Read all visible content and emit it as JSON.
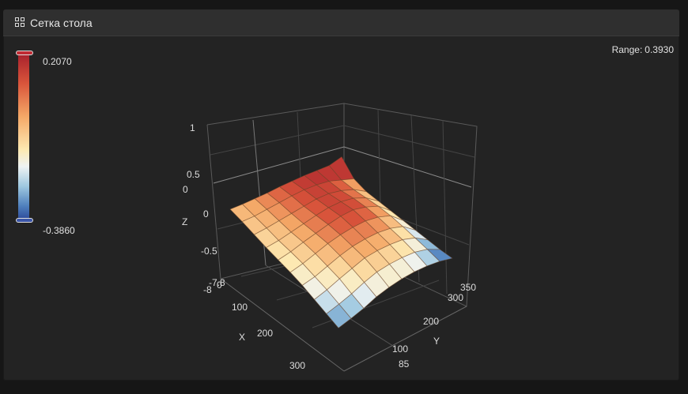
{
  "header": {
    "title": "Сетка стола",
    "icon": "grid-icon"
  },
  "range": {
    "label": "Range:",
    "value": "0.3930"
  },
  "color_scale": {
    "max": "0.2070",
    "min": "-0.3860"
  },
  "axes": {
    "z_label": "Z",
    "x_label": "X",
    "y_label": "Y",
    "z_ticks": [
      "1",
      "0.5",
      "0",
      "0",
      "-0.5",
      "-7.8",
      "-8"
    ],
    "x_ticks": [
      "0",
      "100",
      "200",
      "300"
    ],
    "y_ticks": [
      "350",
      "300",
      "200",
      "100",
      "85"
    ]
  },
  "chart_data": {
    "type": "surface",
    "rows": 10,
    "cols": 10,
    "z": [
      [
        0.0,
        0.02,
        0.05,
        0.08,
        0.12,
        0.15,
        0.18,
        0.2,
        0.22,
        0.3
      ],
      [
        -0.02,
        0.0,
        0.04,
        0.08,
        0.12,
        0.15,
        0.16,
        0.15,
        0.1,
        0.05
      ],
      [
        -0.05,
        -0.02,
        0.02,
        0.06,
        0.1,
        0.14,
        0.15,
        0.12,
        0.06,
        -0.05
      ],
      [
        -0.08,
        -0.05,
        0.0,
        0.05,
        0.1,
        0.14,
        0.15,
        0.12,
        0.04,
        -0.1
      ],
      [
        -0.1,
        -0.06,
        0.0,
        0.05,
        0.1,
        0.14,
        0.15,
        0.1,
        0.02,
        -0.15
      ],
      [
        -0.12,
        -0.08,
        -0.02,
        0.04,
        0.08,
        0.1,
        0.1,
        0.06,
        -0.02,
        -0.2
      ],
      [
        -0.15,
        -0.12,
        -0.06,
        0.0,
        0.04,
        0.05,
        0.04,
        0.0,
        -0.08,
        -0.25
      ],
      [
        -0.2,
        -0.16,
        -0.1,
        -0.05,
        0.0,
        0.0,
        -0.02,
        -0.06,
        -0.15,
        -0.3
      ],
      [
        -0.25,
        -0.22,
        -0.18,
        -0.12,
        -0.08,
        -0.08,
        -0.1,
        -0.14,
        -0.22,
        -0.35
      ],
      [
        -0.3,
        -0.28,
        -0.25,
        -0.2,
        -0.18,
        -0.18,
        -0.2,
        -0.24,
        -0.3,
        -0.386
      ]
    ]
  }
}
